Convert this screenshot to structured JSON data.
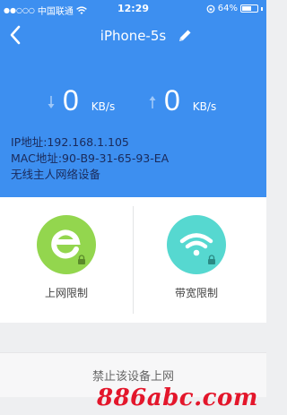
{
  "status_bar": {
    "carrier": "中国联通",
    "time": "12:29",
    "battery": "64%",
    "battery_level": 0.64
  },
  "nav": {
    "title": "iPhone-5s"
  },
  "speeds": {
    "download": {
      "value": "0",
      "unit": "KB/s"
    },
    "upload": {
      "value": "0",
      "unit": "KB/s"
    }
  },
  "device_info": {
    "ip": "IP地址:192.168.1.105",
    "mac": "MAC地址:90-B9-31-65-93-EA",
    "note": "无线主人网络设备"
  },
  "actions": {
    "internet_limit": "上网限制",
    "bandwidth_limit": "带宽限制"
  },
  "block_device": "禁止该设备上网",
  "watermark": "886abc.com",
  "colors": {
    "header_blue": "#3d8ff0",
    "net_green": "#93d64e",
    "bw_cyan": "#56d8d0",
    "watermark_red": "#e3162b"
  }
}
